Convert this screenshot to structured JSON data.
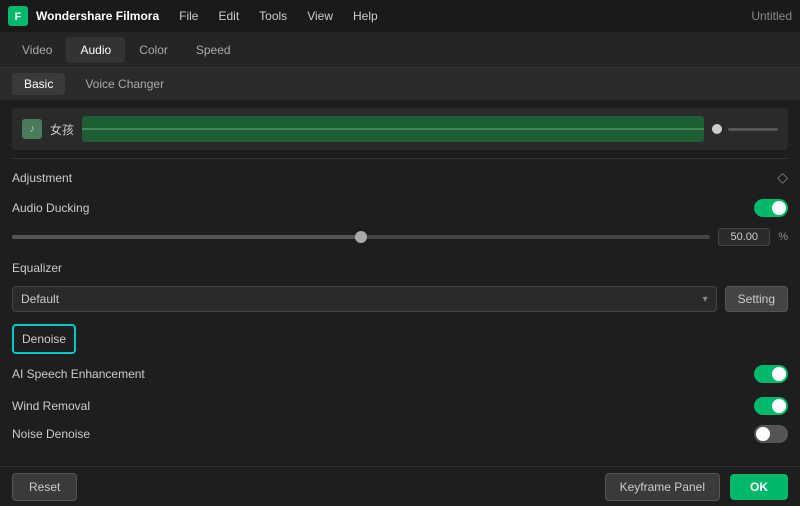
{
  "app": {
    "brand": "Wondershare Filmora",
    "title": "Untitled"
  },
  "menu": {
    "items": [
      "File",
      "Edit",
      "Tools",
      "View",
      "Help"
    ]
  },
  "main_tabs": {
    "items": [
      "Video",
      "Audio",
      "Color",
      "Speed"
    ],
    "active": "Audio"
  },
  "sub_tabs": {
    "items": [
      "Basic",
      "Voice Changer"
    ],
    "active": "Basic"
  },
  "audio_track": {
    "icon": "♪",
    "label": "女孩",
    "vol_value": ""
  },
  "adjustment": {
    "title": "Adjustment",
    "audio_ducking": {
      "label": "Audio Ducking",
      "enabled": true,
      "slider_value": "50.00",
      "slider_unit": "%",
      "slider_fill_pct": 50
    },
    "equalizer": {
      "label": "Equalizer",
      "selected": "Default",
      "setting_btn": "Setting"
    }
  },
  "denoise": {
    "label": "Denoise",
    "ai_speech": {
      "label": "AI Speech Enhancement",
      "enabled": true
    },
    "wind_removal": {
      "label": "Wind Removal",
      "enabled": true
    },
    "noise_denoise": {
      "label": "Noise Denoise",
      "enabled": false
    }
  },
  "bottom": {
    "reset_label": "Reset",
    "keyframe_label": "Keyframe Panel",
    "ok_label": "OK"
  }
}
